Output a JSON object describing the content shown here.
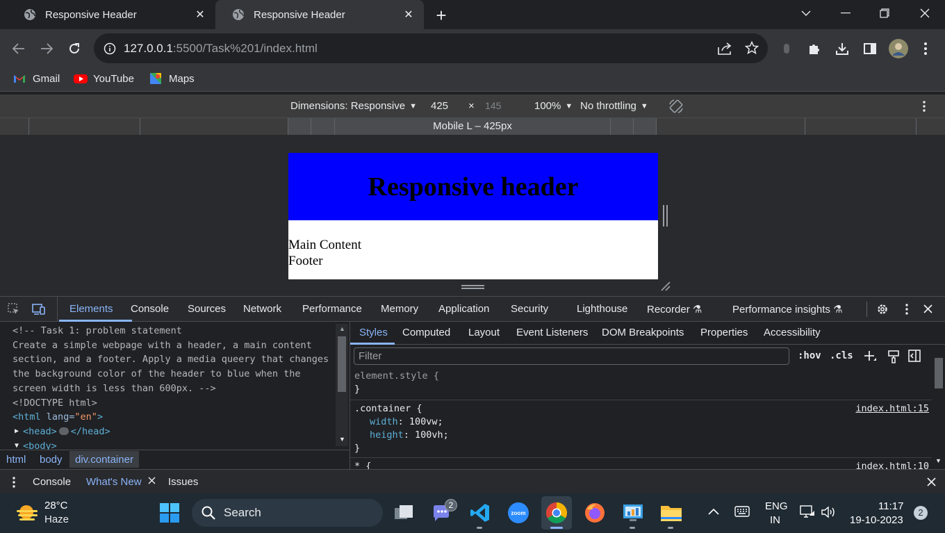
{
  "browser": {
    "tabs": [
      {
        "title": "Responsive Header",
        "active": false
      },
      {
        "title": "Responsive Header",
        "active": true
      }
    ],
    "address": {
      "host": "127.0.0.1",
      "rest": ":5500/Task%201/index.html"
    },
    "bookmarks": [
      {
        "label": "Gmail",
        "icon": "gmail-icon"
      },
      {
        "label": "YouTube",
        "icon": "youtube-icon"
      },
      {
        "label": "Maps",
        "icon": "maps-icon"
      }
    ]
  },
  "device_toolbar": {
    "dimensions": "Dimensions: Responsive",
    "width": "425",
    "times": "×",
    "height": "145",
    "zoom": "100%",
    "throttling": "No throttling",
    "media_label": "Mobile L – 425px"
  },
  "page": {
    "header": "Responsive header",
    "main": "Main Content",
    "footer": "Footer",
    "header_color": "#0000ff"
  },
  "devtools": {
    "tabs": [
      "Elements",
      "Console",
      "Sources",
      "Network",
      "Performance",
      "Memory",
      "Application",
      "Security",
      "Lighthouse",
      "Recorder",
      "Performance insights"
    ],
    "active_tab": "Elements",
    "elements": {
      "comment": [
        "<!-- Task 1: problem statement",
        "Create a simple webpage with a header, a main content",
        "section, and a footer. Apply a media queery that changes",
        "the background color of the header to blue when the",
        "screen width is less than 600px. -->"
      ],
      "doctype": "<!DOCTYPE html>",
      "html_open": "<html",
      "lang_attr": " lang=",
      "lang_val": "\"en\"",
      "html_close": ">",
      "head": "<head>",
      "head_end": "</head>",
      "body": "<body>"
    },
    "breadcrumbs": [
      "html",
      "body",
      "div.container"
    ],
    "styles_tabs": [
      "Styles",
      "Computed",
      "Layout",
      "Event Listeners",
      "DOM Breakpoints",
      "Properties",
      "Accessibility"
    ],
    "filter_placeholder": "Filter",
    "hov": ":hov",
    "cls": ".cls",
    "rules": [
      {
        "selector": "element.style {",
        "close": "}"
      },
      {
        "selector": ".container {",
        "source": "index.html:15",
        "props": [
          {
            "name": "width",
            "value": "100vw;"
          },
          {
            "name": "height",
            "value": "100vh;"
          }
        ],
        "close": "}"
      },
      {
        "selector": "* {",
        "source": "index.html:10"
      }
    ],
    "drawer_tabs": [
      "Console",
      "What's New",
      "Issues"
    ]
  },
  "taskbar": {
    "weather_temp": "28°C",
    "weather_desc": "Haze",
    "search": "Search",
    "teams_badge": "2",
    "zoom_label": "zoom",
    "lang1": "ENG",
    "lang2": "IN",
    "time": "11:17",
    "date": "19-10-2023",
    "notif": "2"
  }
}
